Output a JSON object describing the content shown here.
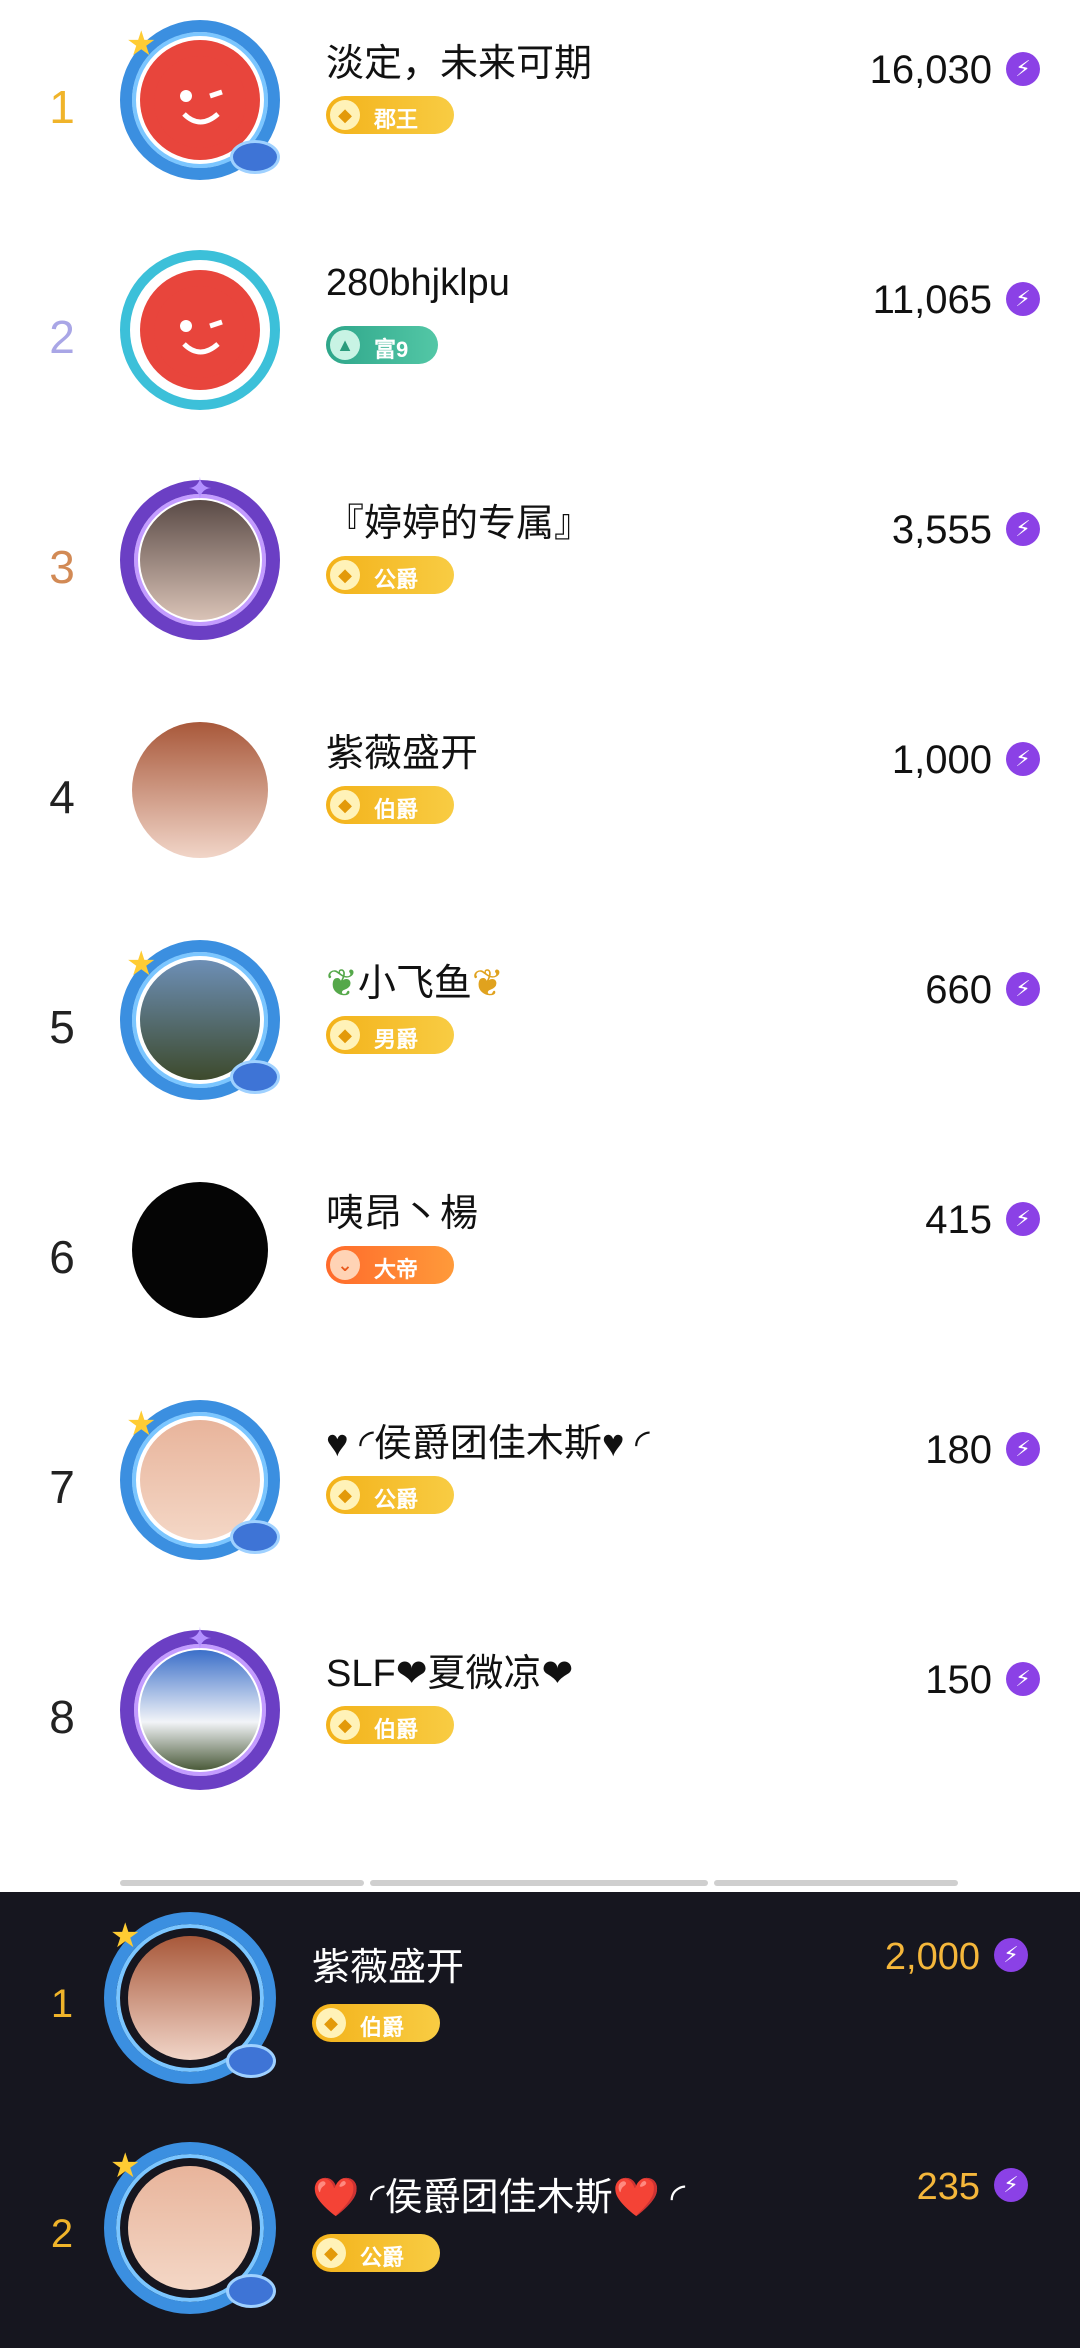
{
  "ranking": [
    {
      "rank": "1",
      "name": "淡定，未来可期",
      "badge": "郡王",
      "badge_style": "gold",
      "score": "16,030",
      "frame": "blue",
      "avatar": "red-face-logo",
      "rank_color": "gold"
    },
    {
      "rank": "2",
      "name": "280bhjklpu",
      "badge": "富9",
      "badge_style": "green",
      "score": "11,065",
      "frame": "cyan",
      "avatar": "red-face-logo",
      "rank_color": "silver"
    },
    {
      "rank": "3",
      "name": "『婷婷的专属』",
      "badge": "公爵",
      "badge_style": "gold",
      "score": "3,555",
      "frame": "purple",
      "avatar": "user-photo",
      "rank_color": "bronze"
    },
    {
      "rank": "4",
      "name": "紫薇盛开",
      "badge": "伯爵",
      "badge_style": "gold",
      "score": "1,000",
      "frame": "none",
      "avatar": "user-photo",
      "rank_color": "plain"
    },
    {
      "rank": "5",
      "name": "小飞鱼",
      "badge": "男爵",
      "badge_style": "gold",
      "score": "660",
      "frame": "blue",
      "avatar": "landscape-photo",
      "rank_color": "plain"
    },
    {
      "rank": "6",
      "name": "咦昂丶楊",
      "badge": "大帝",
      "badge_style": "orange",
      "score": "415",
      "frame": "none",
      "avatar": "black-logo",
      "rank_color": "plain"
    },
    {
      "rank": "7",
      "name": "♥ ◜侯爵团佳木斯♥ ◜",
      "badge": "公爵",
      "badge_style": "gold",
      "score": "180",
      "frame": "blue",
      "avatar": "baby-photo",
      "rank_color": "plain"
    },
    {
      "rank": "8",
      "name": "SLF❤夏微凉❤",
      "badge": "伯爵",
      "badge_style": "gold",
      "score": "150",
      "frame": "purple",
      "avatar": "sky-photo",
      "rank_color": "plain"
    }
  ],
  "panel": [
    {
      "rank": "1",
      "name": "紫薇盛开",
      "badge": "伯爵",
      "score": "2,000",
      "frame": "blue",
      "avatar": "user-photo"
    },
    {
      "rank": "2",
      "name": "❤️ ◜侯爵团佳木斯❤️ ◜",
      "badge": "公爵",
      "score": "235",
      "frame": "blue",
      "avatar": "baby-photo"
    }
  ],
  "icons": {
    "score": "lightning-coin-icon",
    "badge": "coin-icon"
  },
  "colors": {
    "gold": "#f0b42a",
    "panel_bg": "#16161f",
    "score_gold": "#f5b73b",
    "coin_purple": "#8b41e6"
  }
}
